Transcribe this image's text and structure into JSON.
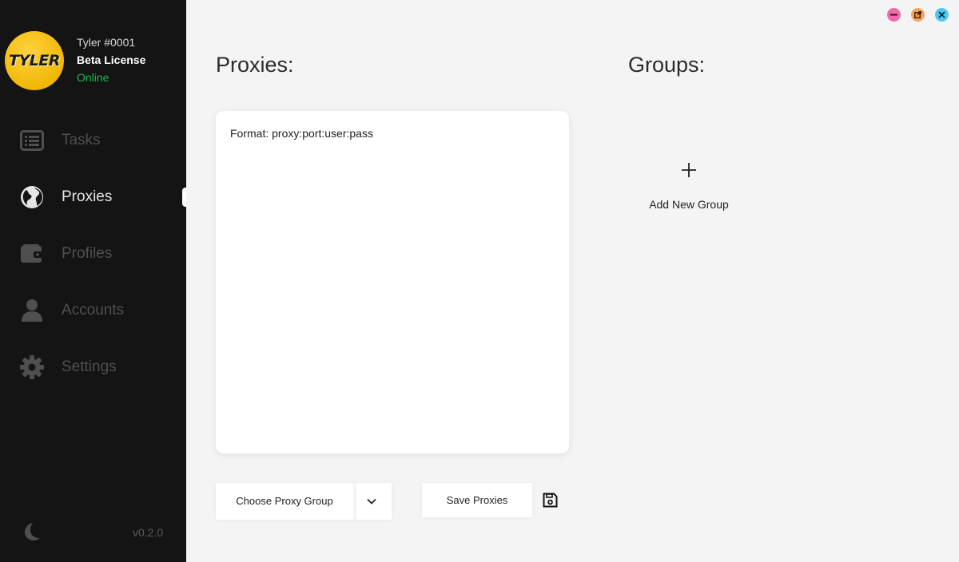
{
  "user": {
    "avatar_text": "TYLER",
    "name": "Tyler #0001",
    "license": "Beta License",
    "status": "Online"
  },
  "nav": [
    {
      "label": "Tasks",
      "icon": "list-icon",
      "active": false
    },
    {
      "label": "Proxies",
      "icon": "globe-icon",
      "active": true
    },
    {
      "label": "Profiles",
      "icon": "wallet-icon",
      "active": false
    },
    {
      "label": "Accounts",
      "icon": "user-icon",
      "active": false
    },
    {
      "label": "Settings",
      "icon": "gear-icon",
      "active": false
    }
  ],
  "footer": {
    "theme_icon": "moon-icon",
    "version": "v0.2.0"
  },
  "window_controls": {
    "minimize_color": "#f06ba8",
    "maximize_color": "#f4a261",
    "close_color": "#4cc9f0"
  },
  "proxies": {
    "title": "Proxies:",
    "placeholder": "Format: proxy:port:user:pass",
    "value": "",
    "group_select_label": "Choose Proxy Group",
    "save_label": "Save Proxies"
  },
  "groups": {
    "title": "Groups:",
    "add_label": "Add New Group"
  },
  "colors": {
    "sidebar_bg": "#141414",
    "status_online": "#22b34a",
    "avatar_accent": "#f2b705"
  }
}
